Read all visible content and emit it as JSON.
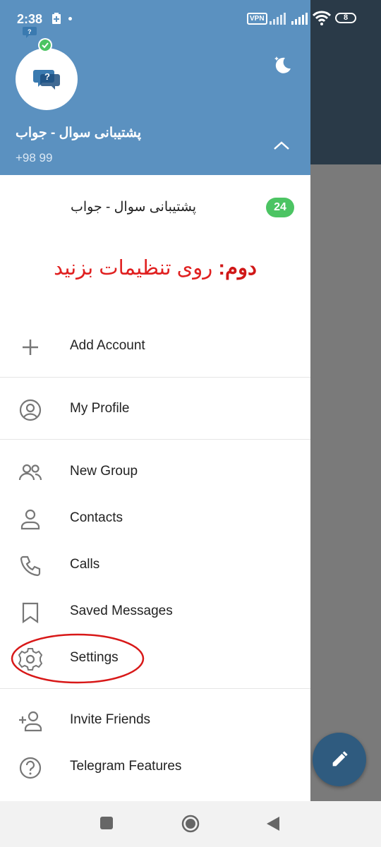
{
  "status_bar": {
    "time": "2:38",
    "vpn": "VPN",
    "battery": "8"
  },
  "header": {
    "account_name": "پشتیبانی سوال - جواب",
    "account_phone": "+98 99",
    "avatar_icon": "question-chat-icon",
    "theme_icon": "moon-icon",
    "expand_icon": "chevron-up-icon",
    "background_color": "#5b91c0"
  },
  "accounts": [
    {
      "name": "پشتیبانی سوال - جواب",
      "unread": "24",
      "badge_color": "#4cc463"
    }
  ],
  "instruction": {
    "prefix": "دوم:",
    "text": " روی تنظیمات بزنید",
    "color": "#e02020"
  },
  "menu": {
    "add_account": "Add Account",
    "my_profile": "My Profile",
    "new_group": "New Group",
    "contacts": "Contacts",
    "calls": "Calls",
    "saved_messages": "Saved Messages",
    "settings": "Settings",
    "invite_friends": "Invite Friends",
    "telegram_features": "Telegram Features"
  },
  "fab": {
    "icon": "pencil-icon",
    "color": "#2f5b7f"
  },
  "nav": {
    "recent": "square-icon",
    "home": "circle-icon",
    "back": "triangle-back-icon"
  }
}
